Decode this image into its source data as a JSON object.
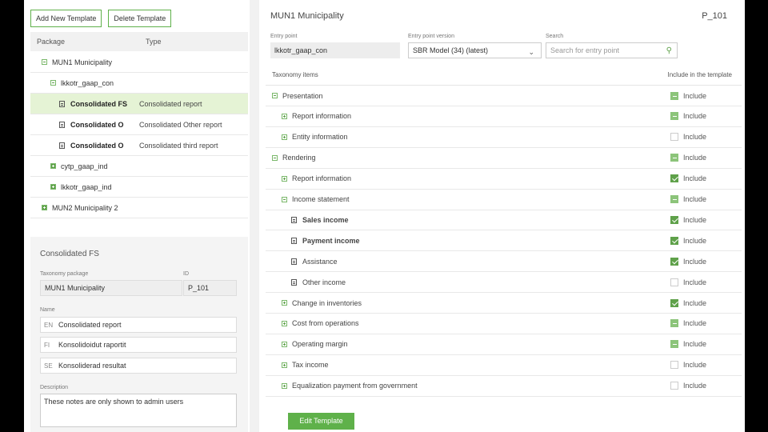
{
  "left": {
    "add_button": "Add New Template",
    "delete_button": "Delete Template",
    "tree_headers": {
      "package": "Package",
      "type": "Type"
    },
    "tree": [
      {
        "label": "MUN1 Municipality",
        "type": ""
      },
      {
        "label": "lkkotr_gaap_con",
        "type": ""
      },
      {
        "label": "Consolidated FS",
        "type": "Consolidated report"
      },
      {
        "label": "Consolidated O",
        "type": "Consolidated Other report"
      },
      {
        "label": "Consolidated O",
        "type": "Consolidated third report"
      },
      {
        "label": "cytp_gaap_ind",
        "type": ""
      },
      {
        "label": "lkkotr_gaap_ind",
        "type": ""
      },
      {
        "label": "MUN2 Municipality 2",
        "type": ""
      }
    ],
    "detail": {
      "title": "Consolidated FS",
      "taxonomy_package_label": "Taxonomy package",
      "taxonomy_package": "MUN1 Municipality",
      "id_label": "ID",
      "id": "P_101",
      "name_label": "Name",
      "names": [
        {
          "code": "EN",
          "value": "Consolidated report"
        },
        {
          "code": "FI",
          "value": "Konsolidoidut raportit"
        },
        {
          "code": "SE",
          "value": "Konsoliderad resultat"
        }
      ],
      "description_label": "Description",
      "description": "These notes are only shown to admin users"
    }
  },
  "right": {
    "title": "MUN1 Municipality",
    "id": "P_101",
    "entry_point_label": "Entry point",
    "entry_point": "lkkotr_gaap_con",
    "version_label": "Entry point version",
    "version": "SBR Model (34) (latest)",
    "search_label": "Search",
    "search_placeholder": "Search for entry point",
    "tax_header": "Taxonomy items",
    "include_header": "Include in the template",
    "include_label": "Include",
    "rows": [
      {
        "label": "Presentation",
        "state": "partial"
      },
      {
        "label": "Report information",
        "state": "partial"
      },
      {
        "label": "Entity information",
        "state": "unchecked"
      },
      {
        "label": "Rendering",
        "state": "partial"
      },
      {
        "label": "Report information",
        "state": "checked"
      },
      {
        "label": "Income statement",
        "state": "partial"
      },
      {
        "label": "Sales income",
        "state": "checked"
      },
      {
        "label": "Payment income",
        "state": "checked"
      },
      {
        "label": "Assistance",
        "state": "checked"
      },
      {
        "label": "Other income",
        "state": "unchecked"
      },
      {
        "label": "Change in inventories",
        "state": "checked"
      },
      {
        "label": "Cost from operations",
        "state": "partial"
      },
      {
        "label": "Operating margin",
        "state": "partial"
      },
      {
        "label": "Tax income",
        "state": "unchecked"
      },
      {
        "label": "Equalization payment from government",
        "state": "unchecked"
      }
    ],
    "edit_button": "Edit Template"
  }
}
